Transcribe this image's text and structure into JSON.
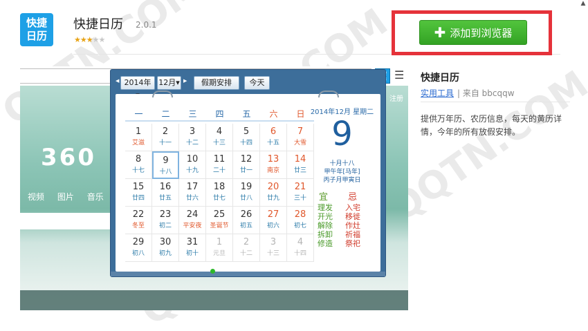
{
  "header": {
    "icon_text_line1": "快捷",
    "icon_text_line2": "日历",
    "title": "快捷日历",
    "version": "2.0.1",
    "stars_on": "★★★",
    "stars_off": "★★",
    "rating": 3,
    "add_button_label": "添加到浏览器",
    "add_button_icon": "plus-icon"
  },
  "preview": {
    "logo_text": "360",
    "nav_links": [
      "视频",
      "图片",
      "音乐"
    ],
    "register_text": "注册",
    "toolbar": {
      "year": "2014年",
      "month": "12月",
      "holiday_button": "假期安排",
      "today_button": "今天"
    },
    "weekdays": [
      "一",
      "二",
      "三",
      "四",
      "五",
      "六",
      "日"
    ],
    "weeks": [
      [
        {
          "d": "1",
          "l": "艾滋"
        },
        {
          "d": "2",
          "l": "十一"
        },
        {
          "d": "3",
          "l": "十二"
        },
        {
          "d": "4",
          "l": "十三"
        },
        {
          "d": "5",
          "l": "十四"
        },
        {
          "d": "6",
          "l": "十五"
        },
        {
          "d": "7",
          "l": "大雪"
        }
      ],
      [
        {
          "d": "8",
          "l": "十七"
        },
        {
          "d": "9",
          "l": "十八"
        },
        {
          "d": "10",
          "l": "十九"
        },
        {
          "d": "11",
          "l": "二十"
        },
        {
          "d": "12",
          "l": "廿一"
        },
        {
          "d": "13",
          "l": "南京"
        },
        {
          "d": "14",
          "l": "廿三"
        }
      ],
      [
        {
          "d": "15",
          "l": "廿四"
        },
        {
          "d": "16",
          "l": "廿五"
        },
        {
          "d": "17",
          "l": "廿六"
        },
        {
          "d": "18",
          "l": "廿七"
        },
        {
          "d": "19",
          "l": "廿八"
        },
        {
          "d": "20",
          "l": "廿九"
        },
        {
          "d": "21",
          "l": "三十"
        }
      ],
      [
        {
          "d": "22",
          "l": "冬至"
        },
        {
          "d": "23",
          "l": "初二"
        },
        {
          "d": "24",
          "l": "平安夜"
        },
        {
          "d": "25",
          "l": "圣诞节"
        },
        {
          "d": "26",
          "l": "初五"
        },
        {
          "d": "27",
          "l": "初六"
        },
        {
          "d": "28",
          "l": "初七"
        }
      ],
      [
        {
          "d": "29",
          "l": "初八"
        },
        {
          "d": "30",
          "l": "初九"
        },
        {
          "d": "31",
          "l": "初十"
        },
        {
          "d": "1",
          "l": "元旦"
        },
        {
          "d": "2",
          "l": "十二"
        },
        {
          "d": "3",
          "l": "十三"
        },
        {
          "d": "4",
          "l": "十四"
        }
      ]
    ],
    "side": {
      "date_line": "2014年12月 星期二",
      "big_day": "9",
      "lunar1": "十月十八",
      "lunar2": "甲午年[马年]",
      "lunar3": "丙子月甲寅日",
      "yi_label": "宜",
      "ji_label": "忌",
      "yi_items": [
        "理发",
        "开光",
        "解除",
        "拆卸",
        "修造"
      ],
      "ji_items": [
        "入宅",
        "移徙",
        "作灶",
        "祈福",
        "祭祀"
      ]
    }
  },
  "right_panel": {
    "title": "快捷日历",
    "category": "实用工具",
    "author": "| 来自 bbcqqw",
    "description": "提供万年历、农历信息，每天的黄历详情，今年的所有放假安排。"
  },
  "watermark": "QQTN.COM",
  "colors": {
    "accent_blue": "#1ea0e6",
    "button_green": "#33a324",
    "highlight_red": "#e5323a",
    "weekend_orange": "#e0572b"
  }
}
